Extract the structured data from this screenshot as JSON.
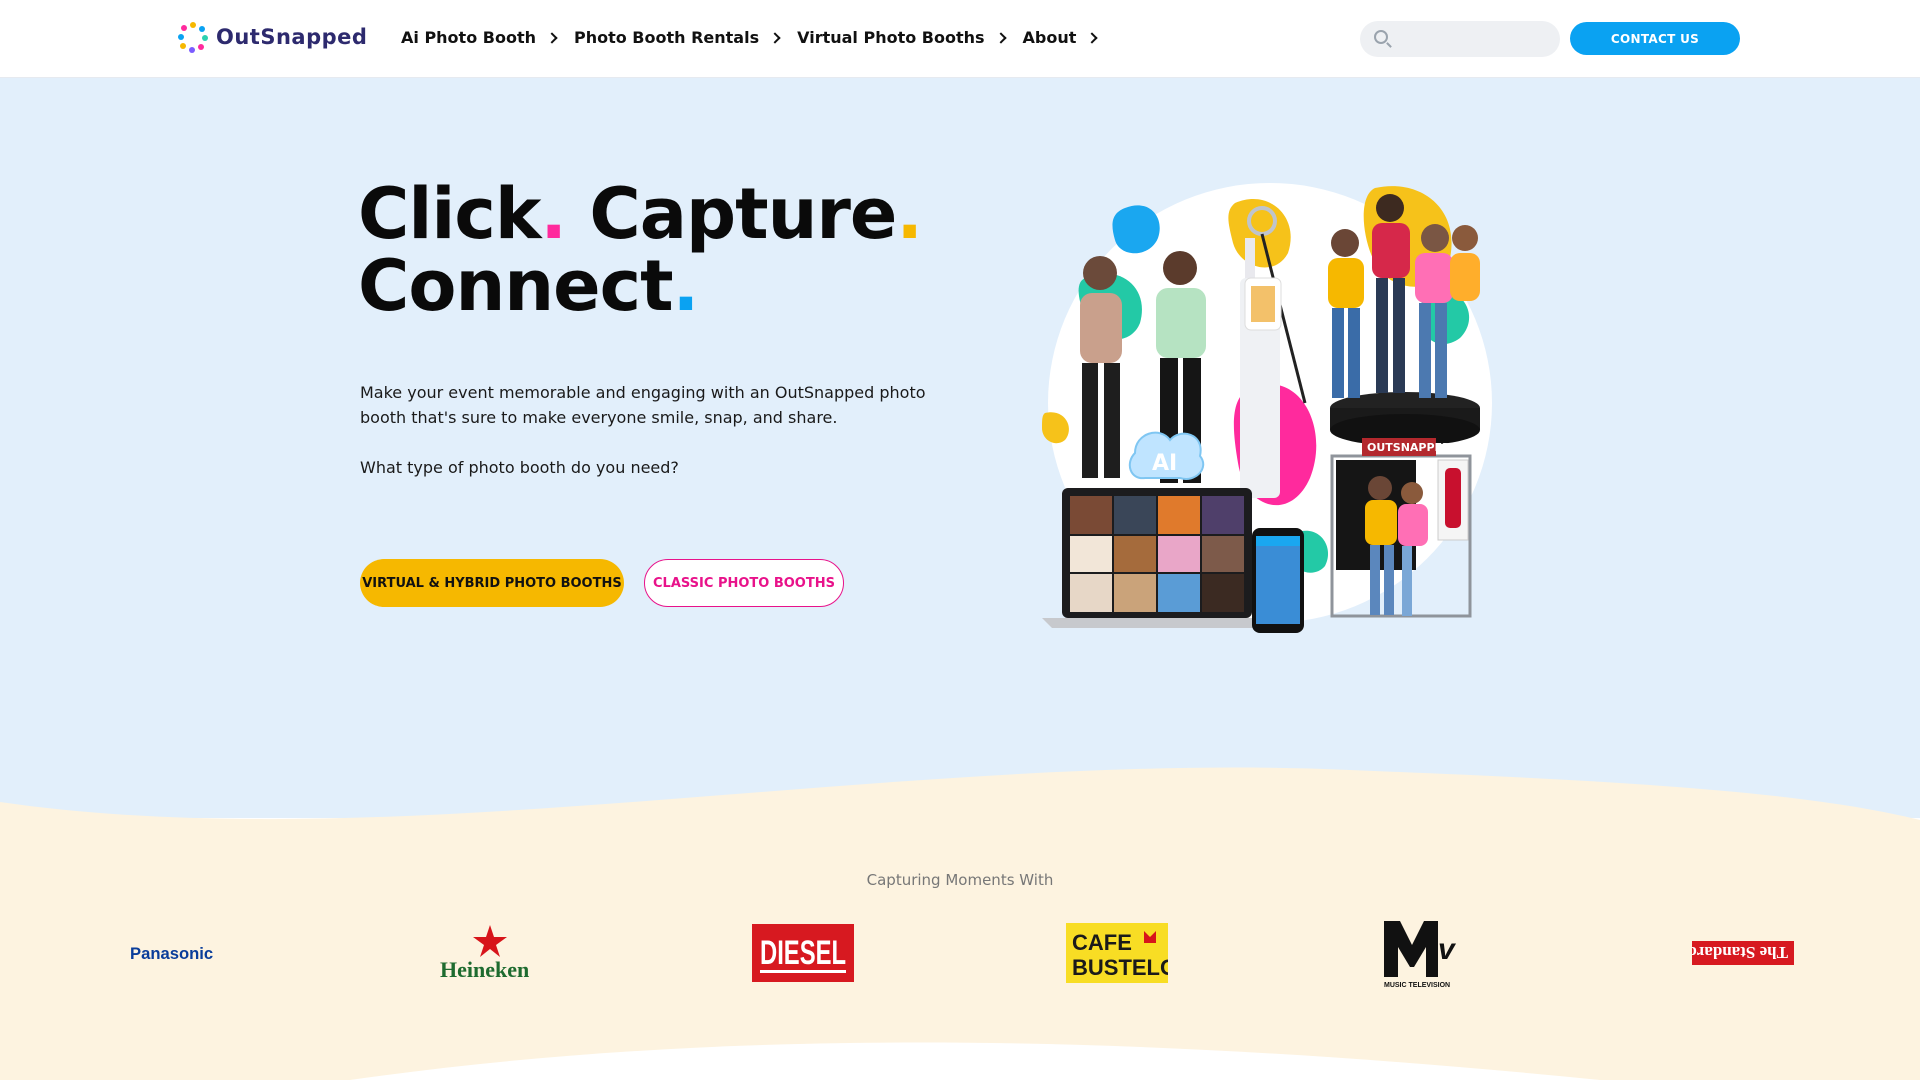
{
  "header": {
    "logo_text": "OutSnapped",
    "nav": [
      {
        "label": "Ai Photo Booth"
      },
      {
        "label": "Photo Booth Rentals"
      },
      {
        "label": "Virtual Photo Booths"
      },
      {
        "label": "About"
      }
    ],
    "search": {
      "placeholder": "",
      "icon": "search-icon"
    },
    "contact_label": "CONTACT US"
  },
  "hero": {
    "title_parts": [
      "Click",
      ".",
      " Capture",
      ".",
      "Connect",
      "."
    ],
    "description": "Make your event memorable and engaging with an OutSnapped photo booth that's sure to make everyone smile, snap, and share.",
    "question": "What type of photo booth do you need?",
    "primary_button": "VIRTUAL & HYBRID PHOTO BOOTHS",
    "secondary_button": "CLASSIC PHOTO BOOTHS"
  },
  "clients": {
    "caption": "Capturing Moments With",
    "logos": [
      "Panasonic",
      "Heineken",
      "DIESEL",
      "CAFE BUSTELO",
      "MTV",
      "The Standard"
    ]
  },
  "colors": {
    "accent_blue": "#0aa2f2",
    "accent_yellow": "#f6b800",
    "accent_pink": "#e8128a",
    "hero_bg": "#e2effb",
    "band_bg": "#fdf3e0"
  }
}
